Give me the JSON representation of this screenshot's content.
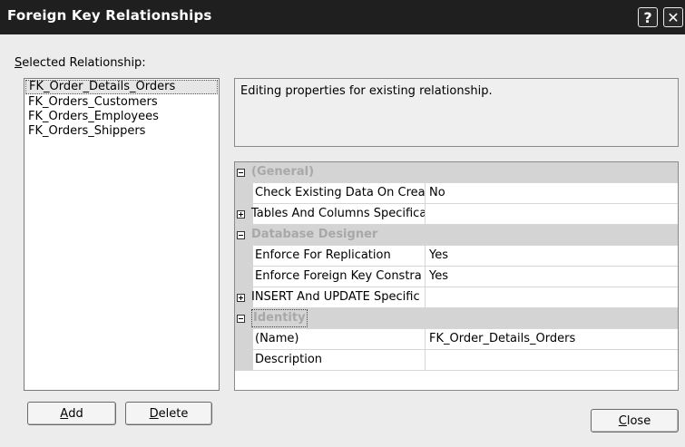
{
  "window": {
    "title": "Foreign Key Relationships",
    "help_glyph": "?",
    "close_glyph": "✕"
  },
  "selected_label": {
    "accel": "S",
    "rest": "elected Relationship:"
  },
  "relationships": [
    "FK_Order_Details_Orders",
    "FK_Orders_Customers",
    "FK_Orders_Employees",
    "FK_Orders_Shippers"
  ],
  "description": "Editing properties for existing relationship.",
  "grid": {
    "general": {
      "label": "(General)",
      "check_existing": {
        "name": "Check Existing Data On Crea",
        "value": "No"
      },
      "tables_columns": {
        "name": "Tables And Columns Specifica",
        "value": ""
      }
    },
    "database_designer": {
      "label": "Database Designer",
      "enforce_replication": {
        "name": "Enforce For Replication",
        "value": "Yes"
      },
      "enforce_fk": {
        "name": "Enforce Foreign Key Constra",
        "value": "Yes"
      },
      "insert_update": {
        "name": "INSERT And UPDATE Specific",
        "value": ""
      }
    },
    "identity": {
      "label": "Identity",
      "name_row": {
        "name": "(Name)",
        "value": "FK_Order_Details_Orders"
      },
      "description_row": {
        "name": "Description",
        "value": ""
      }
    }
  },
  "buttons": {
    "add": {
      "accel": "A",
      "rest": "dd"
    },
    "delete": {
      "accel": "D",
      "rest": "elete"
    },
    "close": {
      "accel": "C",
      "rest": "lose"
    }
  }
}
